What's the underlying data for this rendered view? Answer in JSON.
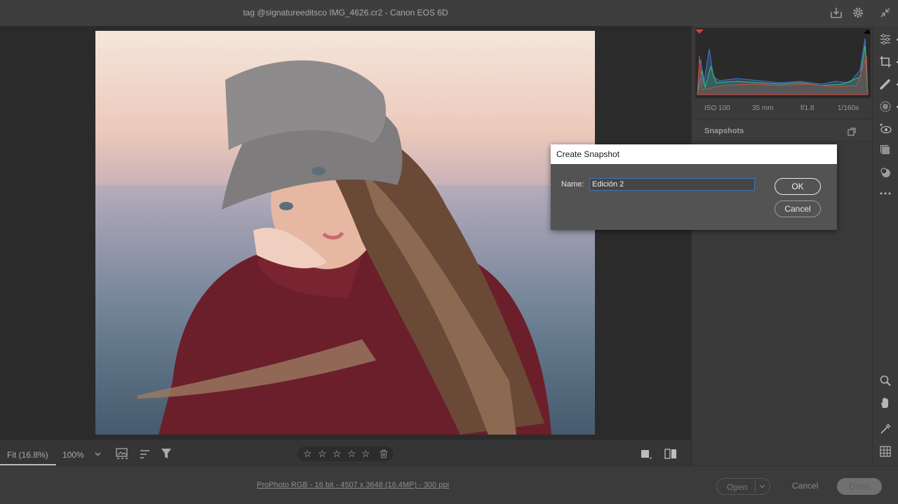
{
  "window": {
    "title": "tag @signatureeditsco IMG_4626.cr2  -  Canon EOS 6D"
  },
  "header_icons": [
    "save-icon",
    "gear-icon",
    "collapse-icon"
  ],
  "histogram": {
    "meta": {
      "iso": "ISO 100",
      "focal": "35 mm",
      "aperture": "f/1.8",
      "shutter": "1/160s"
    }
  },
  "snapshots": {
    "title": "Snapshots"
  },
  "toolbar": {
    "zoom_fit": "Fit (16.8%)",
    "zoom_pct": "100%",
    "stars": [
      "☆",
      "☆",
      "☆",
      "☆",
      "☆"
    ]
  },
  "bottom": {
    "info": "ProPhoto RGB - 16 bit - 4507 x 3648 (16.4MP) - 300 ppi",
    "open": "Open",
    "cancel": "Cancel",
    "done": "Done"
  },
  "dialog": {
    "title": "Create Snapshot",
    "name_label": "Name:",
    "name_value": "Edición 2",
    "ok": "OK",
    "cancel": "Cancel"
  },
  "colors": {
    "accent_focus": "#3f72b6",
    "clip_warning": "#e0383e"
  }
}
